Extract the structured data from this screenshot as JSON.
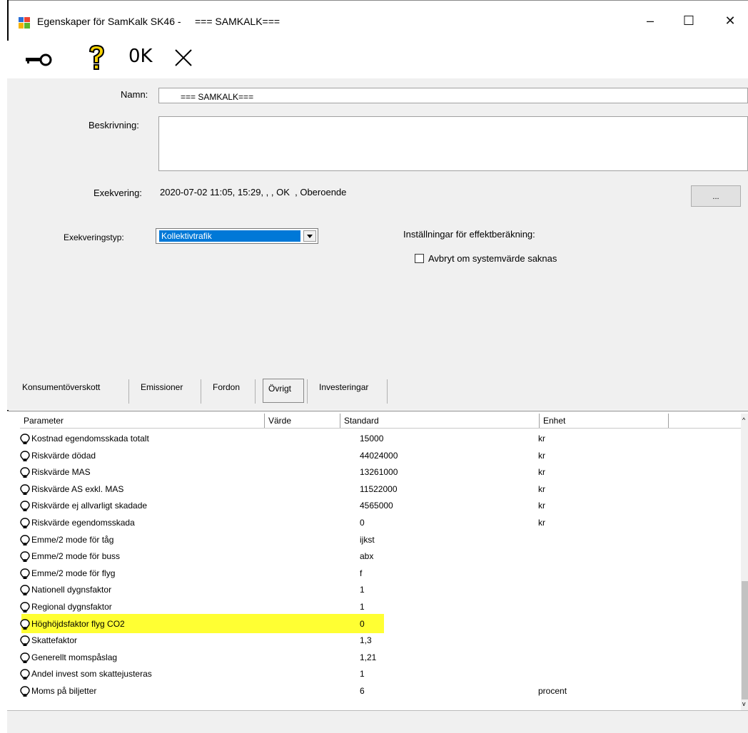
{
  "window": {
    "title": "Egenskaper för SamKalk SK46 -     === SAMKALK===",
    "minimize": "–",
    "maximize": "☐",
    "close": "✕"
  },
  "toolbar": {
    "ok_label": "0K",
    "key_icon": "key-icon",
    "help_icon": "help-icon",
    "cancel_icon": "x-icon"
  },
  "form": {
    "name_label": "Namn:",
    "name_value": "=== SAMKALK===",
    "description_label": "Beskrivning:",
    "description_value": "",
    "execution_label": "Exekvering:",
    "execution_value": "2020-07-02 11:05, 15:29, , , OK  , Oberoende",
    "execution_button": "...",
    "exec_type_label": "Exekveringstyp:",
    "exec_type_value": "Kollektivtrafik",
    "effect_settings_label": "Inställningar för effektberäkning:",
    "abort_checkbox_label": "Avbryt om systemvärde saknas",
    "abort_checked": false
  },
  "tabs": [
    "Konsumentöverskott",
    "Emissioner",
    "Fordon",
    "Övrigt",
    "Investeringar"
  ],
  "active_tab": "Övrigt",
  "grid": {
    "columns": [
      "Parameter",
      "Värde",
      "Standard",
      "Enhet"
    ],
    "rows": [
      {
        "parameter": "Kostnad egendomsskada totalt",
        "value": "",
        "standard": "15000",
        "unit": "kr"
      },
      {
        "parameter": "Riskvärde dödad",
        "value": "",
        "standard": "44024000",
        "unit": "kr"
      },
      {
        "parameter": "Riskvärde MAS",
        "value": "",
        "standard": "13261000",
        "unit": "kr"
      },
      {
        "parameter": "Riskvärde AS exkl. MAS",
        "value": "",
        "standard": "11522000",
        "unit": "kr"
      },
      {
        "parameter": "Riskvärde ej allvarligt skadade",
        "value": "",
        "standard": "4565000",
        "unit": "kr"
      },
      {
        "parameter": "Riskvärde egendomsskada",
        "value": "",
        "standard": "0",
        "unit": "kr"
      },
      {
        "parameter": "Emme/2 mode för tåg",
        "value": "",
        "standard": "ijkst",
        "unit": ""
      },
      {
        "parameter": "Emme/2 mode för buss",
        "value": "",
        "standard": "abx",
        "unit": ""
      },
      {
        "parameter": "Emme/2 mode för flyg",
        "value": "",
        "standard": "f",
        "unit": ""
      },
      {
        "parameter": "Nationell dygnsfaktor",
        "value": "",
        "standard": "1",
        "unit": ""
      },
      {
        "parameter": "Regional dygnsfaktor",
        "value": "",
        "standard": "1",
        "unit": ""
      },
      {
        "parameter": "Höghöjdsfaktor flyg CO2",
        "value": "",
        "standard": "0",
        "unit": ""
      },
      {
        "parameter": "Skattefaktor",
        "value": "",
        "standard": "1,3",
        "unit": ""
      },
      {
        "parameter": "Generellt momspåslag",
        "value": "",
        "standard": "1,21",
        "unit": ""
      },
      {
        "parameter": "Andel invest som skattejusteras",
        "value": "",
        "standard": "1",
        "unit": ""
      },
      {
        "parameter": "Moms på biljetter",
        "value": "",
        "standard": "6",
        "unit": "procent"
      }
    ]
  },
  "colors": {
    "highlight": "#ffff33",
    "selection": "#0078d7",
    "panel": "#f0f0f0"
  }
}
